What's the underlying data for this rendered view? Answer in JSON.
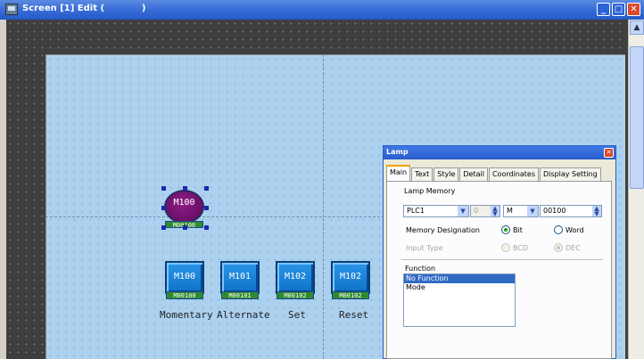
{
  "window": {
    "title": "Screen [1] Edit (            )",
    "buttons": {
      "minimize": "_",
      "restore": "□",
      "close": "✕"
    }
  },
  "scrollbar": {
    "up_arrow": "▲"
  },
  "lamp": {
    "label": "M100",
    "tag": "M00100",
    "color": "#6a0f66"
  },
  "switches": [
    {
      "label": "M100",
      "tag": "M00100",
      "caption": "Momentary"
    },
    {
      "label": "M101",
      "tag": "M00101",
      "caption": "Alternate"
    },
    {
      "label": "M102",
      "tag": "M00102",
      "caption": "Set"
    },
    {
      "label": "M102",
      "tag": "M00102",
      "caption": "Reset"
    }
  ],
  "dialog": {
    "title": "Lamp",
    "close": "✕",
    "tabs": [
      "Main",
      "Text",
      "Style",
      "Detail",
      "Coordinates",
      "Display Setting"
    ],
    "active_tab": "Main",
    "lamp_memory_label": "Lamp Memory",
    "plc_value": "PLC1",
    "station_value": "0",
    "device_value": "M",
    "address_value": "00100",
    "memory_designation_label": "Memory Designation",
    "bit_label": "Bit",
    "word_label": "Word",
    "input_type_label": "Input Type",
    "bcd_label": "BCD",
    "dec_label": "DEC",
    "function_label": "Function",
    "function_options": [
      "No Function",
      "Mode"
    ],
    "selected_function": "No Function"
  },
  "colors": {
    "accent": "#316ac5",
    "screen_bg": "#acd1ef",
    "switch_blue": "#1a85de",
    "tag_green": "#2e8a2e"
  }
}
